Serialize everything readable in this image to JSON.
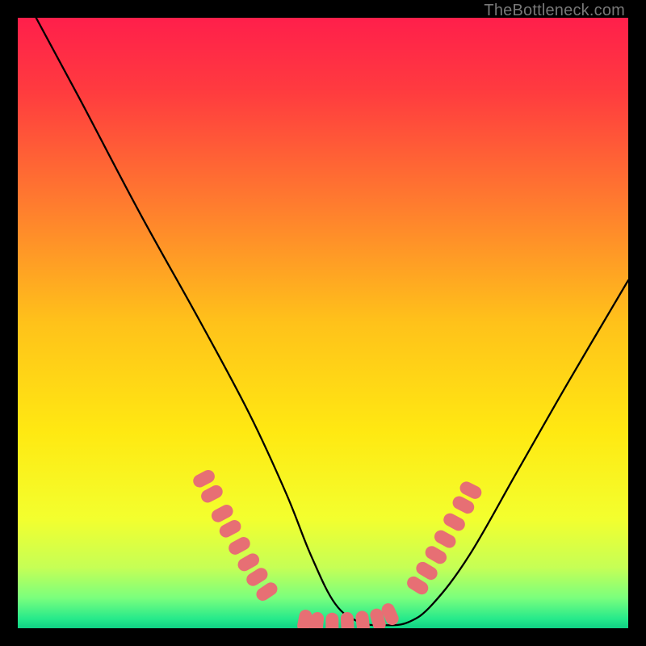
{
  "watermark": "TheBottleneck.com",
  "gradient": {
    "stops": [
      {
        "offset": 0.0,
        "color": "#ff1f4b"
      },
      {
        "offset": 0.12,
        "color": "#ff3b3f"
      },
      {
        "offset": 0.3,
        "color": "#ff7a2f"
      },
      {
        "offset": 0.5,
        "color": "#ffc21a"
      },
      {
        "offset": 0.68,
        "color": "#ffe912"
      },
      {
        "offset": 0.82,
        "color": "#f3ff2e"
      },
      {
        "offset": 0.9,
        "color": "#c6ff55"
      },
      {
        "offset": 0.95,
        "color": "#7bff7d"
      },
      {
        "offset": 0.985,
        "color": "#25e98b"
      },
      {
        "offset": 1.0,
        "color": "#10d184"
      }
    ]
  },
  "chart_data": {
    "type": "line",
    "title": "",
    "xlabel": "",
    "ylabel": "",
    "xlim": [
      0,
      100
    ],
    "ylim": [
      0,
      100
    ],
    "grid": false,
    "series": [
      {
        "name": "bottleneck-curve",
        "x": [
          3,
          10,
          20,
          30,
          38,
          44,
          48,
          52,
          56,
          60,
          64,
          68,
          74,
          82,
          90,
          100
        ],
        "y": [
          100,
          87,
          68,
          50,
          35,
          22,
          12,
          4,
          1,
          0.5,
          1,
          4,
          12,
          26,
          40,
          57
        ]
      }
    ],
    "highlight_segments": [
      {
        "comment": "left descending pink lozenge markers",
        "points": [
          {
            "x": 30.5,
            "y": 24.5
          },
          {
            "x": 31.8,
            "y": 22.0
          },
          {
            "x": 33.5,
            "y": 18.8
          },
          {
            "x": 34.8,
            "y": 16.3
          },
          {
            "x": 36.3,
            "y": 13.5
          },
          {
            "x": 37.8,
            "y": 10.8
          },
          {
            "x": 39.2,
            "y": 8.4
          },
          {
            "x": 40.8,
            "y": 6.0
          }
        ]
      },
      {
        "comment": "valley floor pink lozenge markers",
        "points": [
          {
            "x": 47.0,
            "y": 1.2
          },
          {
            "x": 49.0,
            "y": 0.8
          },
          {
            "x": 51.5,
            "y": 0.7
          },
          {
            "x": 54.0,
            "y": 0.8
          },
          {
            "x": 56.5,
            "y": 1.0
          },
          {
            "x": 59.0,
            "y": 1.4
          },
          {
            "x": 61.0,
            "y": 2.3
          }
        ]
      },
      {
        "comment": "right ascending pink lozenge markers",
        "points": [
          {
            "x": 65.5,
            "y": 7.0
          },
          {
            "x": 67.0,
            "y": 9.4
          },
          {
            "x": 68.5,
            "y": 12.0
          },
          {
            "x": 70.0,
            "y": 14.6
          },
          {
            "x": 71.5,
            "y": 17.4
          },
          {
            "x": 73.0,
            "y": 20.2
          },
          {
            "x": 74.2,
            "y": 22.6
          }
        ]
      }
    ],
    "marker_style": {
      "color": "#e76f74",
      "width": 16,
      "height": 28,
      "rx": 8
    }
  }
}
